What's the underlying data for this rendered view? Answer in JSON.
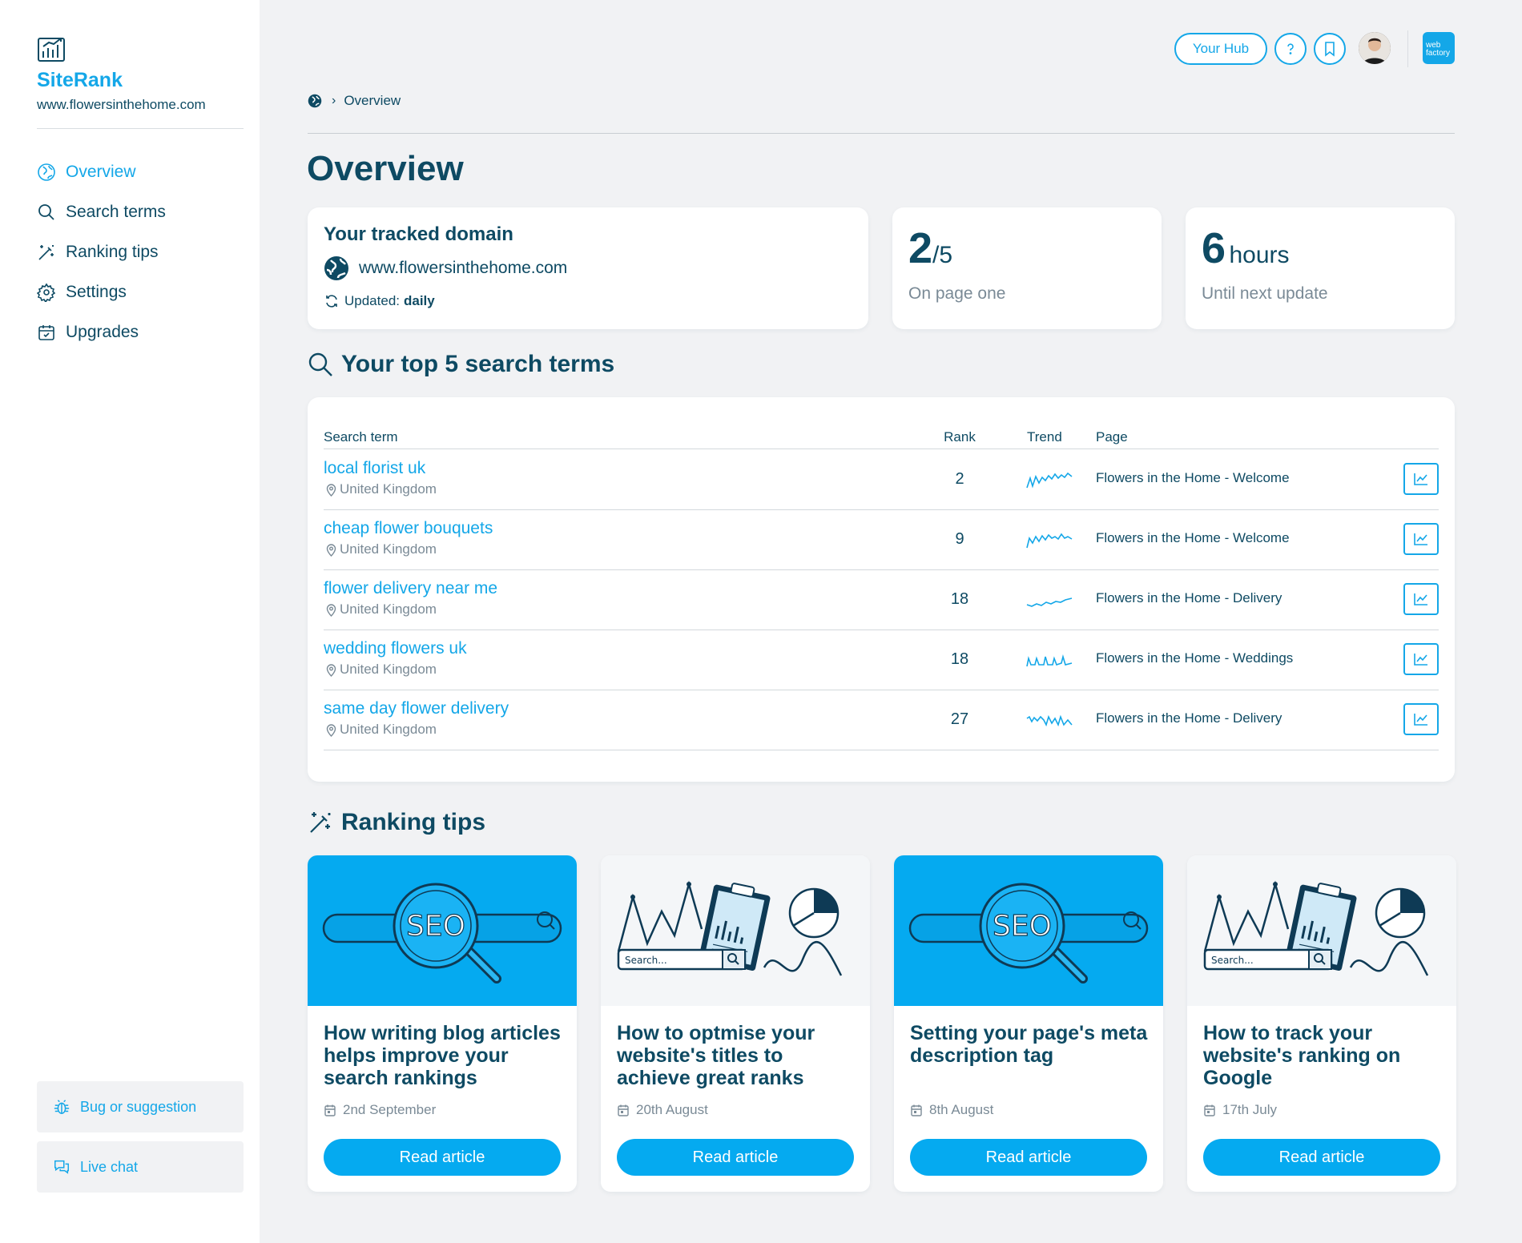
{
  "app": {
    "name": "SiteRank",
    "domain": "www.flowersinthehome.com"
  },
  "sidebar": {
    "items": [
      {
        "label": "Overview",
        "icon": "compass-icon",
        "active": true
      },
      {
        "label": "Search terms",
        "icon": "search-icon",
        "active": false
      },
      {
        "label": "Ranking tips",
        "icon": "magic-wand-icon",
        "active": false
      },
      {
        "label": "Settings",
        "icon": "gear-icon",
        "active": false
      },
      {
        "label": "Upgrades",
        "icon": "calendar-icon",
        "active": false
      }
    ],
    "bug_label": "Bug or suggestion",
    "chat_label": "Live chat"
  },
  "header": {
    "hub_label": "Your Hub",
    "help_icon": "question-icon",
    "bookmark_icon": "bookmark-icon",
    "logo_text": "web factory"
  },
  "breadcrumb": {
    "current": "Overview"
  },
  "page_title": "Overview",
  "domain_card": {
    "title": "Your tracked domain",
    "domain": "www.flowersinthehome.com",
    "updated_label": "Updated:",
    "updated_value": "daily"
  },
  "stats": [
    {
      "value": "2",
      "suffix": "/5",
      "label": "On page one"
    },
    {
      "value": "6",
      "suffix": "hours",
      "label": "Until next update"
    }
  ],
  "search_terms": {
    "title": "Your top 5 search terms",
    "columns": {
      "term": "Search term",
      "rank": "Rank",
      "trend": "Trend",
      "page": "Page"
    },
    "rows": [
      {
        "term": "local florist uk",
        "location": "United Kingdom",
        "rank": "2",
        "page": "Flowers in the Home - Welcome"
      },
      {
        "term": "cheap flower bouquets",
        "location": "United Kingdom",
        "rank": "9",
        "page": "Flowers in the Home - Welcome"
      },
      {
        "term": "flower delivery near me",
        "location": "United Kingdom",
        "rank": "18",
        "page": "Flowers in the Home - Delivery"
      },
      {
        "term": "wedding flowers uk",
        "location": "United Kingdom",
        "rank": "18",
        "page": "Flowers in the Home - Weddings"
      },
      {
        "term": "same day flower delivery",
        "location": "United Kingdom",
        "rank": "27",
        "page": "Flowers in the Home - Delivery"
      }
    ]
  },
  "ranking_tips": {
    "title": "Ranking tips",
    "button_label": "Read article",
    "seo_image_text": "SEO",
    "search_image_text": "Search...",
    "cards": [
      {
        "title": "How writing blog articles helps improve your search rankings",
        "date": "2nd September",
        "image": "seo-magnifier"
      },
      {
        "title": "How to optmise your website's titles to achieve great ranks",
        "date": "20th August",
        "image": "search-charts"
      },
      {
        "title": "Setting your page's meta description tag",
        "date": "8th August",
        "image": "seo-magnifier"
      },
      {
        "title": "How to track your website's ranking on Google",
        "date": "17th July",
        "image": "search-charts"
      }
    ]
  },
  "colors": {
    "accent": "#14a7e8",
    "button": "#05aaf0",
    "text": "#0e4a63",
    "muted": "#7a8a96",
    "background": "#f1f2f4"
  }
}
